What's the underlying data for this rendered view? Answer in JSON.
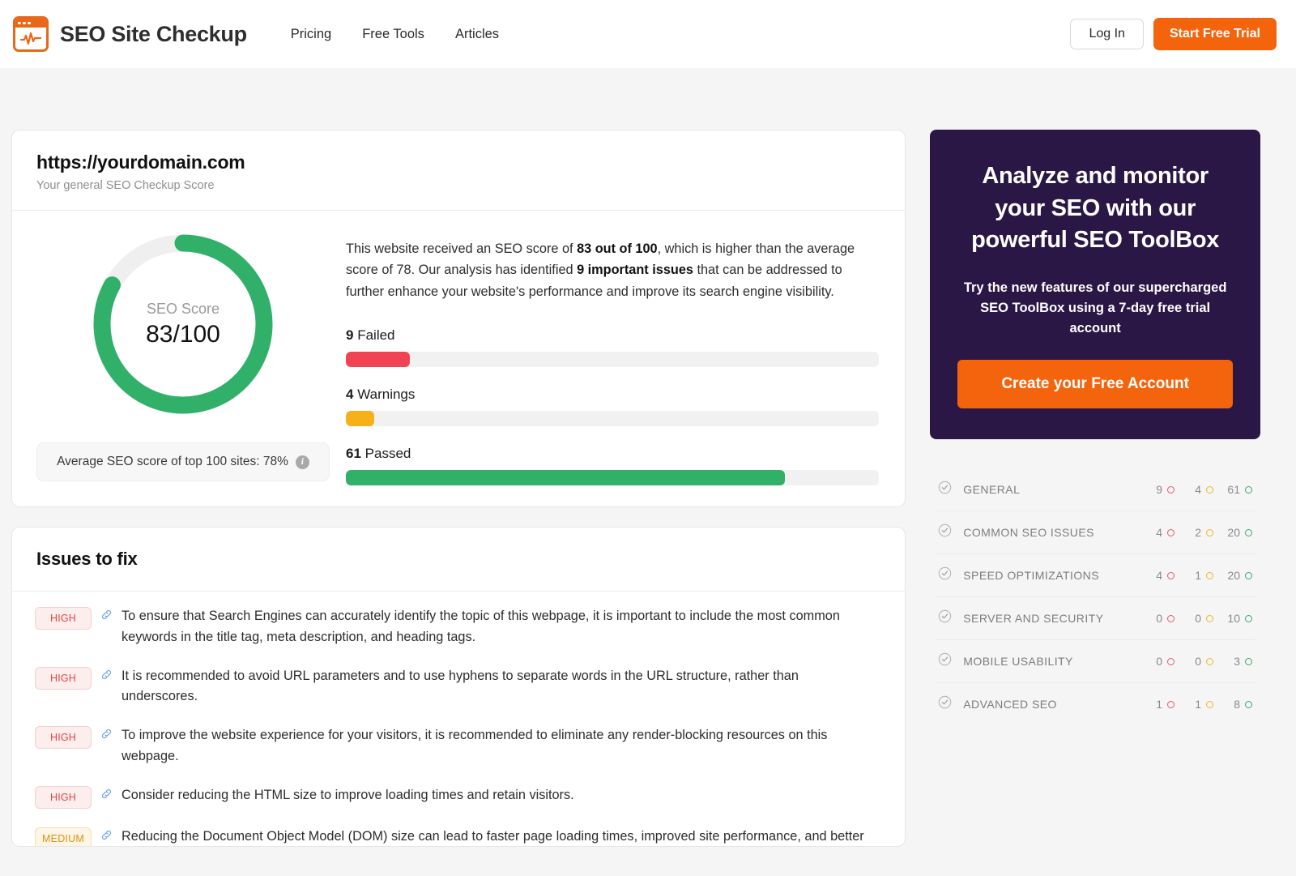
{
  "header": {
    "brand_name": "SEO Site Checkup",
    "logo_icon": "browser-pulse-icon",
    "nav": [
      {
        "label": "Pricing"
      },
      {
        "label": "Free Tools"
      },
      {
        "label": "Articles"
      }
    ],
    "login_label": "Log In",
    "trial_label": "Start Free Trial"
  },
  "score_card": {
    "domain": "https://yourdomain.com",
    "subtitle": "Your general SEO Checkup Score",
    "donut_label": "SEO Score",
    "donut_value": "83/100",
    "average_pill_text": "Average SEO score of top 100 sites: 78%",
    "info_icon": "info-icon",
    "summary_parts": {
      "p1": "This website received an SEO score of ",
      "b1": "83 out of 100",
      "p2": ", which is higher than the average score of 78. Our analysis has identified ",
      "b2": "9 important issues",
      "p3": " that can be addressed to further enhance your website's performance and improve its search engine visibility."
    },
    "bars": [
      {
        "count": "9",
        "label": "Failed",
        "percent": 12,
        "color": "#f04455"
      },
      {
        "count": "4",
        "label": "Warnings",
        "percent": 5.3,
        "color": "#f6b11a"
      },
      {
        "count": "61",
        "label": "Passed",
        "percent": 82.4,
        "color": "#31b06a"
      }
    ]
  },
  "issues": {
    "title": "Issues to fix",
    "items": [
      {
        "severity": "HIGH",
        "severity_class": "sev-high",
        "text": "To ensure that Search Engines can accurately identify the topic of this webpage, it is important to include the most common keywords in the title tag, meta description, and heading tags."
      },
      {
        "severity": "HIGH",
        "severity_class": "sev-high",
        "text": "It is recommended to avoid URL parameters and to use hyphens to separate words in the URL structure, rather than underscores."
      },
      {
        "severity": "HIGH",
        "severity_class": "sev-high",
        "text": "To improve the website experience for your visitors, it is recommended to eliminate any render-blocking resources on this webpage."
      },
      {
        "severity": "HIGH",
        "severity_class": "sev-high",
        "text": "Consider reducing the HTML size to improve loading times and retain visitors."
      },
      {
        "severity": "MEDIUM",
        "severity_class": "sev-medium",
        "text": "Reducing the Document Object Model (DOM) size can lead to faster page loading times, improved site performance, and better user experience by decreasing the amount of time it takes for the browser to process and render the page."
      }
    ]
  },
  "promo": {
    "title": "Analyze and monitor your SEO with our powerful SEO ToolBox",
    "subtitle": "Try the new features of our supercharged SEO ToolBox using a 7-day free trial account",
    "button_label": "Create your Free Account",
    "background_color": "#2a1745",
    "button_color": "#f4640c"
  },
  "categories": [
    {
      "name": "GENERAL",
      "failed": "9",
      "warnings": "4",
      "passed": "61"
    },
    {
      "name": "COMMON SEO ISSUES",
      "failed": "4",
      "warnings": "2",
      "passed": "20"
    },
    {
      "name": "SPEED OPTIMIZATIONS",
      "failed": "4",
      "warnings": "1",
      "passed": "20"
    },
    {
      "name": "SERVER AND SECURITY",
      "failed": "0",
      "warnings": "0",
      "passed": "10"
    },
    {
      "name": "MOBILE USABILITY",
      "failed": "0",
      "warnings": "0",
      "passed": "3"
    },
    {
      "name": "ADVANCED SEO",
      "failed": "1",
      "warnings": "1",
      "passed": "8"
    }
  ],
  "chart_data": {
    "type": "pie",
    "title": "SEO Score",
    "value": 83,
    "max": 100,
    "percent": 83,
    "track_color": "#efefef",
    "fill_color": "#31b06a"
  }
}
